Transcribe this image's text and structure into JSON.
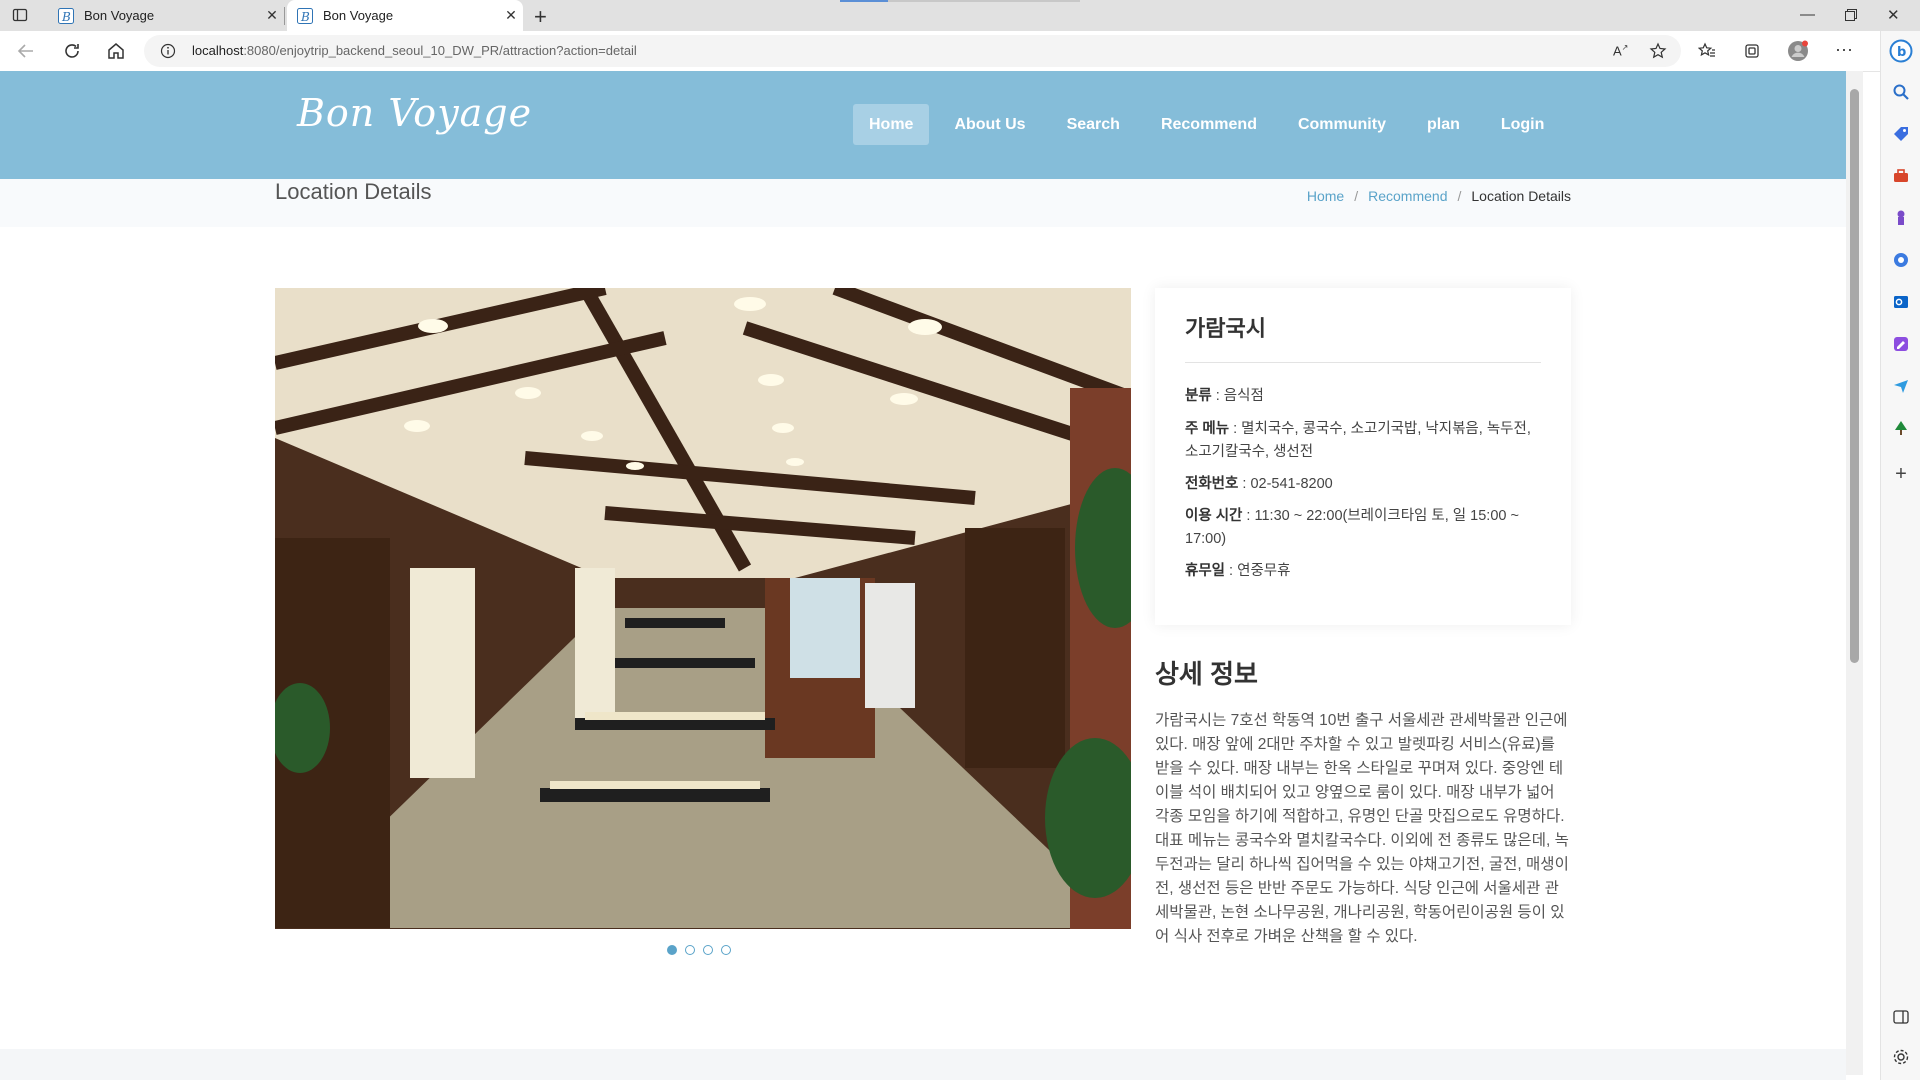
{
  "browser": {
    "tabs": [
      {
        "title": "Bon Voyage",
        "active": false
      },
      {
        "title": "Bon Voyage",
        "active": true
      }
    ],
    "url_host": "localhost",
    "url_rest": ":8080/enjoytrip_backend_seoul_10_DW_PR/attraction?action=detail"
  },
  "site": {
    "logo": "Bon Voyage",
    "nav": [
      "Home",
      "About Us",
      "Search",
      "Recommend",
      "Community",
      "plan",
      "Login"
    ],
    "active_nav": "Home"
  },
  "page": {
    "title": "Location Details",
    "breadcrumb": [
      "Home",
      "Recommend",
      "Location Details"
    ]
  },
  "place": {
    "name": "가람국시",
    "category_label": "분류",
    "category": "음식점",
    "menu_label": "주 메뉴",
    "menu": "멸치국수, 콩국수, 소고기국밥, 낙지볶음, 녹두전, 소고기칼국수, 생선전",
    "phone_label": "전화번호",
    "phone": "02-541-8200",
    "hours_label": "이용 시간",
    "hours": "11:30 ~ 22:00(브레이크타임 토, 일 15:00 ~ 17:00)",
    "closed_label": "휴무일",
    "closed": "연중무휴"
  },
  "detail": {
    "heading": "상세 정보",
    "text": "가람국시는 7호선 학동역 10번 출구 서울세관 관세박물관 인근에 있다. 매장 앞에 2대만 주차할 수 있고 발렛파킹 서비스(유료)를 받을 수 있다. 매장 내부는 한옥 스타일로 꾸며져 있다. 중앙엔 테이블 석이 배치되어 있고 양옆으로 룸이 있다. 매장 내부가 넓어 각종 모임을 하기에 적합하고, 유명인 단골 맛집으로도 유명하다. 대표 메뉴는 콩국수와 멸치칼국수다. 이외에 전 종류도 많은데, 녹두전과는 달리 하나씩 집어먹을 수 있는 야채고기전, 굴전, 매생이전, 생선전 등은 반반 주문도 가능하다. 식당 인근에 서울세관 관세박물관, 논현 소나무공원, 개나리공원, 학동어린이공원 등이 있어 식사 전후로 가벼운 산책을 할 수 있다."
  },
  "carousel": {
    "count": 4,
    "active": 1
  },
  "colors": {
    "header": "#85bdd9",
    "accent": "#5aa3c9"
  }
}
